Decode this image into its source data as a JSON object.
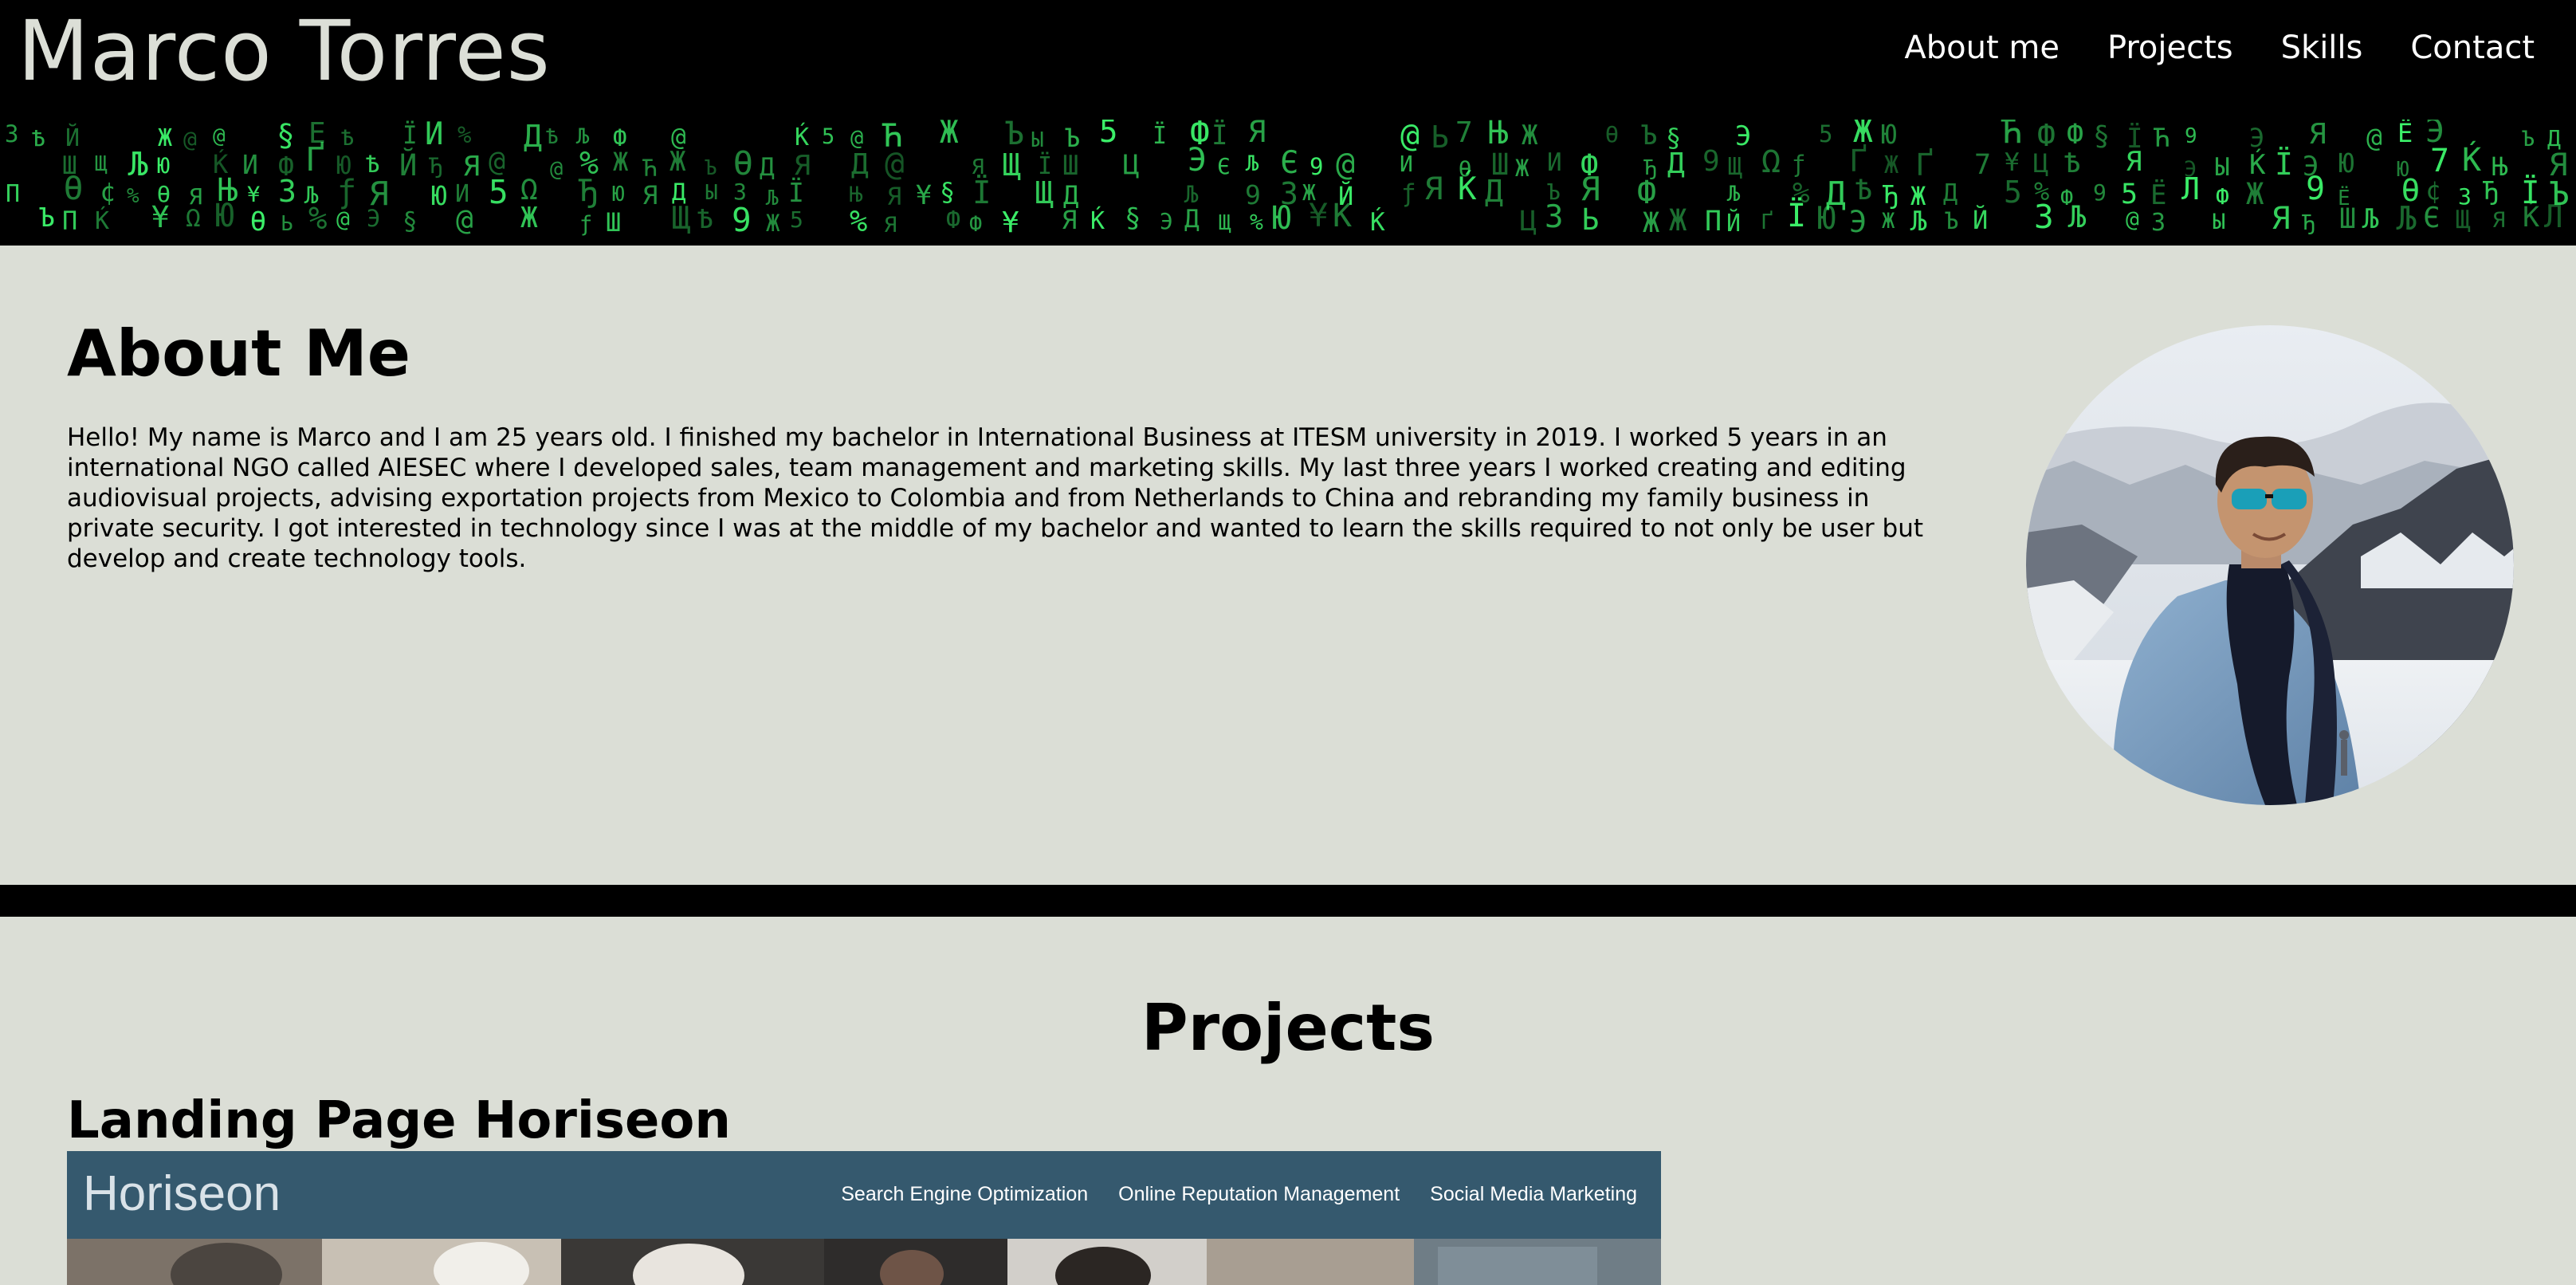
{
  "header": {
    "title": "Marco Torres",
    "nav": [
      "About me",
      "Projects",
      "Skills",
      "Contact"
    ]
  },
  "banner": {
    "glyphs": "ЖҐЯЮ@ФЩЇ5ЪЁ9ДЦΩЉЛ%ЂЋƒ¢ЮЬѢЗИ§ЫЙЂЊП¥ЩЖЭЌШЯ7Ж@ЉѲДЄЯФЙ"
  },
  "about": {
    "heading": "About Me",
    "text": "Hello! My name is Marco and I am 25 years old. I finished my bachelor in International Business at ITESM university in 2019. I worked 5 years in an international NGO called AIESEC where I developed sales, team management and marketing skills. My last three years I worked creating and editing audiovisual projects, advising exportation projects from Mexico to Colombia and from Netherlands to China and rebranding my family business in private security. I got interested in technology since I was at the middle of my bachelor and wanted to learn the skills required to not only be user but develop and create technology tools."
  },
  "projects": {
    "heading": "Projects",
    "items": [
      {
        "title": "Landing Page Horiseon",
        "preview": {
          "logo": "Horiseon",
          "nav": [
            "Search Engine Optimization",
            "Online Reputation Management",
            "Social Media Marketing"
          ]
        }
      }
    ]
  },
  "colors": {
    "page_bg": "#dbded6",
    "header_bg": "#000000",
    "title_color": "#dcdfd7",
    "matrix_green": "#3cf26a",
    "preview_header": "#35596e"
  }
}
